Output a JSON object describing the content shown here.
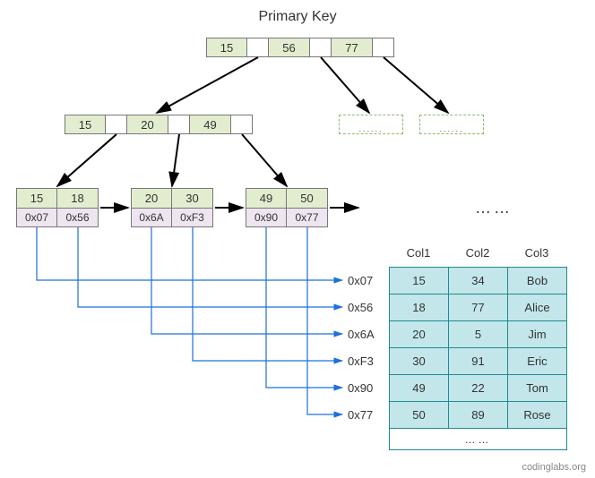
{
  "title": "Primary Key",
  "root": {
    "keys": [
      "15",
      "56",
      "77"
    ]
  },
  "internal": {
    "keys": [
      "15",
      "20",
      "49"
    ]
  },
  "placeholders": {
    "dots": "......"
  },
  "leaves": [
    {
      "keys": [
        "15",
        "18"
      ],
      "ptrs": [
        "0x07",
        "0x56"
      ]
    },
    {
      "keys": [
        "20",
        "30"
      ],
      "ptrs": [
        "0x6A",
        "0xF3"
      ]
    },
    {
      "keys": [
        "49",
        "50"
      ],
      "ptrs": [
        "0x90",
        "0x77"
      ]
    }
  ],
  "leaf_ellipsis": "……",
  "ptr_labels": [
    "0x07",
    "0x56",
    "0x6A",
    "0xF3",
    "0x90",
    "0x77"
  ],
  "table": {
    "cols": [
      "Col1",
      "Col2",
      "Col3"
    ],
    "rows": [
      [
        "15",
        "34",
        "Bob"
      ],
      [
        "18",
        "77",
        "Alice"
      ],
      [
        "20",
        "5",
        "Jim"
      ],
      [
        "30",
        "91",
        "Eric"
      ],
      [
        "49",
        "22",
        "Tom"
      ],
      [
        "50",
        "89",
        "Rose"
      ]
    ],
    "ellipsis": "……"
  },
  "watermark": "codinglabs.org",
  "chart_data": {
    "type": "table",
    "description": "B+Tree index diagram with primary key pointing to heap records",
    "root_keys": [
      15,
      56,
      77
    ],
    "internal_keys": [
      15,
      20,
      49
    ],
    "leaf_nodes": [
      {
        "keys": [
          15,
          18
        ],
        "pointers": [
          "0x07",
          "0x56"
        ]
      },
      {
        "keys": [
          20,
          30
        ],
        "pointers": [
          "0x6A",
          "0xF3"
        ]
      },
      {
        "keys": [
          49,
          50
        ],
        "pointers": [
          "0x90",
          "0x77"
        ]
      }
    ],
    "data_rows": [
      {
        "addr": "0x07",
        "Col1": 15,
        "Col2": 34,
        "Col3": "Bob"
      },
      {
        "addr": "0x56",
        "Col1": 18,
        "Col2": 77,
        "Col3": "Alice"
      },
      {
        "addr": "0x6A",
        "Col1": 20,
        "Col2": 5,
        "Col3": "Jim"
      },
      {
        "addr": "0xF3",
        "Col1": 30,
        "Col2": 91,
        "Col3": "Eric"
      },
      {
        "addr": "0x90",
        "Col1": 49,
        "Col2": 22,
        "Col3": "Tom"
      },
      {
        "addr": "0x77",
        "Col1": 50,
        "Col2": 89,
        "Col3": "Rose"
      }
    ]
  }
}
